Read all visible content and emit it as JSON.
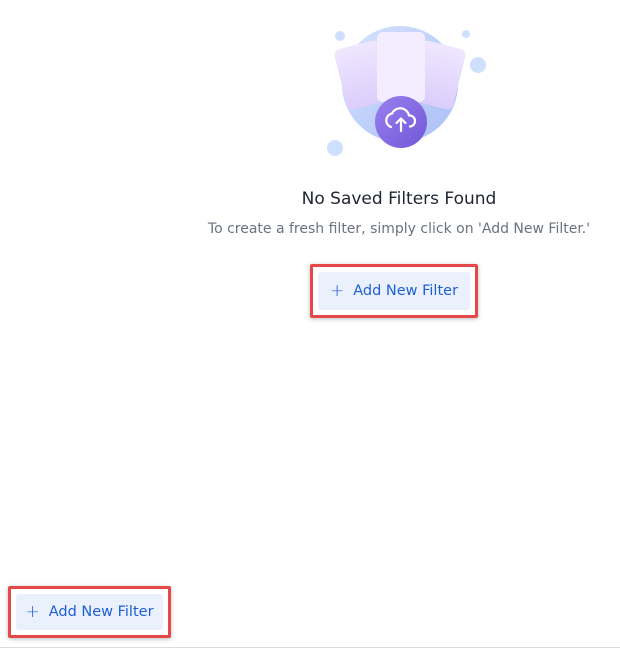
{
  "empty_state": {
    "illustration_icon": "cloud-upload-icon",
    "title": "No Saved Filters Found",
    "subtitle": "To create a fresh filter, simply click on 'Add New Filter.'"
  },
  "primary_action": {
    "icon": "plus-icon",
    "plus": "+",
    "label": "Add New Filter"
  },
  "footer_action": {
    "icon": "plus-icon",
    "plus": "+",
    "label": "Add New Filter"
  },
  "colors": {
    "accent": "#1f5fd6",
    "button_bg": "#eaf1fc",
    "highlight": "#e54848",
    "title": "#1f2430",
    "subtitle": "#6b7280"
  }
}
